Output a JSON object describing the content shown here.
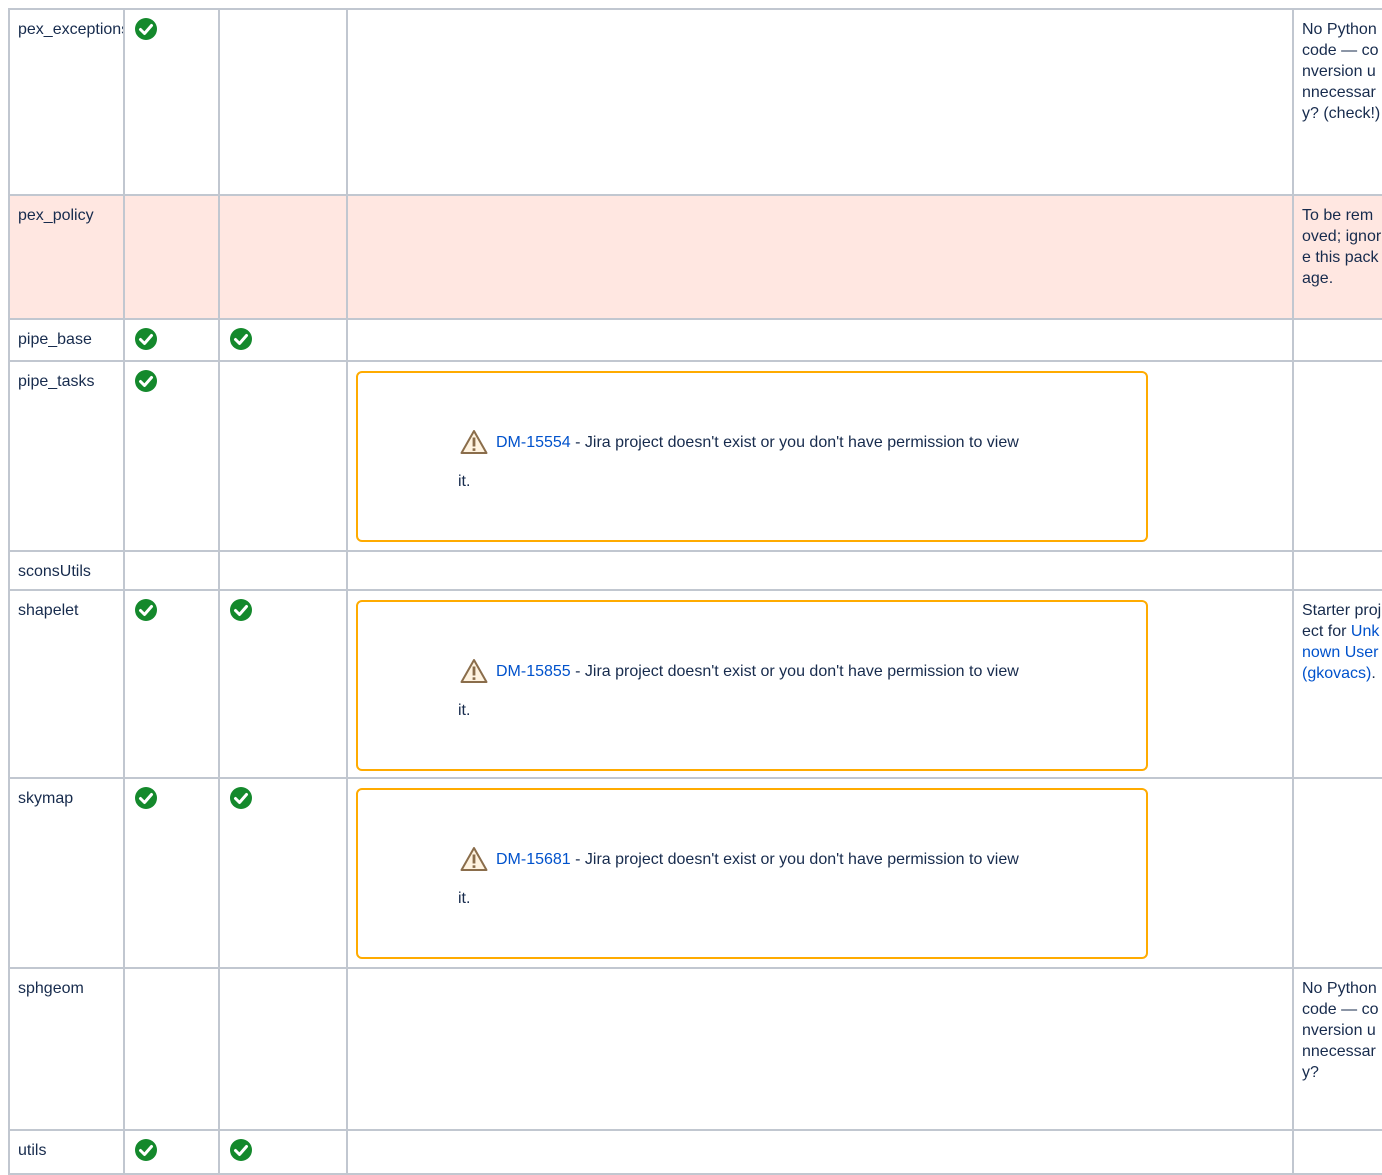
{
  "rows": [
    {
      "name": "pex_exceptions",
      "col2": true,
      "col3": false,
      "note": "No Python code — conversion unnecessary? (check!)"
    },
    {
      "name": "pex_policy",
      "col2": false,
      "col3": false,
      "note": "To be removed; ignore this package."
    },
    {
      "name": "pipe_base",
      "col2": true,
      "col3": true,
      "note": ""
    },
    {
      "name": "pipe_tasks",
      "col2": true,
      "col3": false,
      "jira": {
        "key": "DM-15554",
        "message": " - Jira project doesn't exist or you don't have permission to view",
        "message_end": "it."
      },
      "note": ""
    },
    {
      "name": "sconsUtils",
      "col2": false,
      "col3": false,
      "note": ""
    },
    {
      "name": "shapelet",
      "col2": true,
      "col3": true,
      "jira": {
        "key": "DM-15855",
        "message": " - Jira project doesn't exist or you don't have permission to view",
        "message_end": "it."
      },
      "note_prefix": "Starter project for ",
      "note_link": "Unknown User (gkovacs)",
      "note_suffix": "."
    },
    {
      "name": "skymap",
      "col2": true,
      "col3": true,
      "jira": {
        "key": "DM-15681",
        "message": " - Jira project doesn't exist or you don't have permission to view",
        "message_end": "it."
      },
      "note": ""
    },
    {
      "name": "sphgeom",
      "col2": false,
      "col3": false,
      "note": "No Python code — conversion unnecessary?"
    },
    {
      "name": "utils",
      "col2": true,
      "col3": true,
      "note": ""
    }
  ],
  "colors": {
    "border": "#c1c7d0",
    "highlight_row": "#ffe7e1",
    "check": "#14892c",
    "jira_border": "#ffab00",
    "link": "#0052cc"
  },
  "icons": {
    "check": "check-circle-icon",
    "warning": "warning-icon"
  }
}
